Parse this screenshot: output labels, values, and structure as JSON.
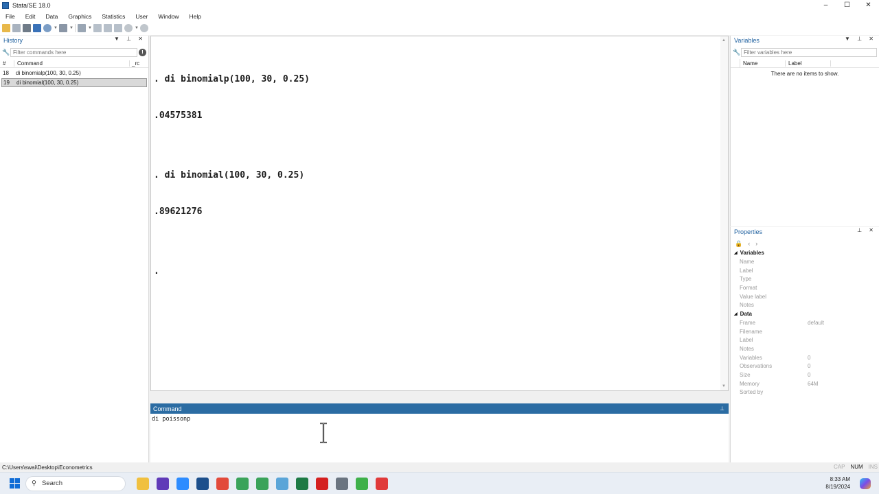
{
  "window": {
    "title": "Stata/SE 18.0",
    "controls": [
      "–",
      "☐",
      "✕"
    ]
  },
  "menu": [
    "File",
    "Edit",
    "Data",
    "Graphics",
    "Statistics",
    "User",
    "Window",
    "Help"
  ],
  "history": {
    "title": "History",
    "filter_placeholder": "Filter commands here",
    "columns": [
      "#",
      "Command",
      "_rc"
    ],
    "rows": [
      {
        "num": "18",
        "command": "di binomialp(100, 30, 0.25)"
      },
      {
        "num": "19",
        "command": "di binomial(100, 30, 0.25)"
      }
    ]
  },
  "results": {
    "lines": [
      ". di binomialp(100, 30, 0.25)",
      ".04575381",
      "",
      ". di binomial(100, 30, 0.25)",
      ".89621276",
      "",
      "."
    ]
  },
  "command": {
    "title": "Command",
    "value": "di poissonp"
  },
  "variables": {
    "title": "Variables",
    "filter_placeholder": "Filter variables here",
    "columns": [
      "Name",
      "Label"
    ],
    "empty_text": "There are no items to show."
  },
  "properties": {
    "title": "Properties",
    "sections": [
      {
        "name": "Variables",
        "rows": [
          {
            "key": "Name",
            "value": ""
          },
          {
            "key": "Label",
            "value": ""
          },
          {
            "key": "Type",
            "value": ""
          },
          {
            "key": "Format",
            "value": ""
          },
          {
            "key": "Value label",
            "value": ""
          },
          {
            "key": "Notes",
            "value": ""
          }
        ]
      },
      {
        "name": "Data",
        "rows": [
          {
            "key": "Frame",
            "value": "default"
          },
          {
            "key": "Filename",
            "value": ""
          },
          {
            "key": "Label",
            "value": ""
          },
          {
            "key": "Notes",
            "value": ""
          },
          {
            "key": "Variables",
            "value": "0"
          },
          {
            "key": "Observations",
            "value": "0"
          },
          {
            "key": "Size",
            "value": "0"
          },
          {
            "key": "Memory",
            "value": "64M"
          },
          {
            "key": "Sorted by",
            "value": ""
          }
        ]
      }
    ]
  },
  "status": {
    "path": "C:\\Users\\swai\\Desktop\\Econometrics",
    "cap": "CAP",
    "num": "NUM",
    "ins": "INS"
  },
  "taskbar": {
    "search_label": "Search",
    "time": "8:33 AM",
    "date": "8/19/2024",
    "apps": [
      {
        "name": "file-explorer",
        "color": "#f0c040"
      },
      {
        "name": "yahoo-finance",
        "color": "#5f3ab8"
      },
      {
        "name": "zoom",
        "color": "#2d8cff"
      },
      {
        "name": "stata",
        "color": "#1c4f8c"
      },
      {
        "name": "chrome",
        "color": "#e24a3b"
      },
      {
        "name": "chrome-profile-2",
        "color": "#3aa35a"
      },
      {
        "name": "chrome-profile-3",
        "color": "#3aa35a"
      },
      {
        "name": "remote-desktop",
        "color": "#5aa5d8"
      },
      {
        "name": "excel",
        "color": "#1d7a45"
      },
      {
        "name": "acrobat",
        "color": "#d42020"
      },
      {
        "name": "settings",
        "color": "#6a7480"
      },
      {
        "name": "camtasia",
        "color": "#3eb04a"
      },
      {
        "name": "recorder",
        "color": "#e03a3a"
      }
    ]
  },
  "colors": {
    "accent": "#2b6ca3",
    "panel_title": "#1d5f9e"
  }
}
